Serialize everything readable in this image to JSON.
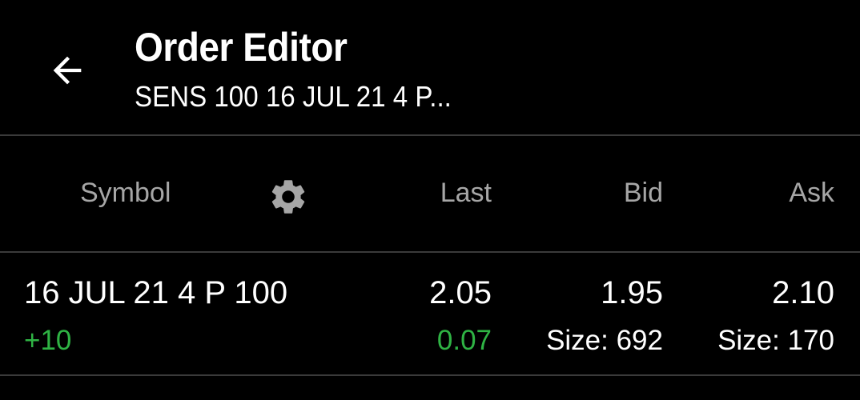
{
  "header": {
    "back_icon": "arrow-left-icon",
    "title": "Order Editor",
    "subtitle": "SENS 100 16 JUL 21 4 P..."
  },
  "columns": {
    "symbol": "Symbol",
    "settings_icon": "gear-icon",
    "last": "Last",
    "bid": "Bid",
    "ask": "Ask"
  },
  "row": {
    "symbol": "16 JUL 21 4 P 100",
    "position": "+10",
    "last": "2.05",
    "change": "0.07",
    "bid": "1.95",
    "bid_size": "Size: 692",
    "ask": "2.10",
    "ask_size": "Size: 170"
  },
  "colors": {
    "background": "#000000",
    "text": "#ffffff",
    "header_text": "#a6a6a6",
    "positive": "#2fb344",
    "divider": "#3a3a3a"
  }
}
